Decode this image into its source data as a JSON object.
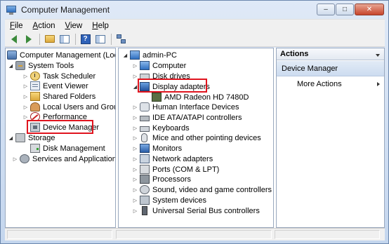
{
  "window": {
    "title": "Computer Management",
    "controls": {
      "minimize": "–",
      "maximize": "□",
      "close": "✕"
    }
  },
  "menubar": {
    "items": [
      {
        "label": "File",
        "accel": "F",
        "rest": "ile"
      },
      {
        "label": "Action",
        "accel": "A",
        "rest": "ction"
      },
      {
        "label": "View",
        "accel": "V",
        "rest": "iew"
      },
      {
        "label": "Help",
        "accel": "H",
        "rest": "elp"
      }
    ]
  },
  "toolbar": {
    "icons": [
      "back-arrow-icon",
      "forward-arrow-icon",
      "up-folder-icon",
      "show-hide-console-tree-icon",
      "help-icon",
      "show-hide-action-pane-icon",
      "connect-network-icon"
    ],
    "help_glyph": "?"
  },
  "left_tree": {
    "root": "Computer Management (Local",
    "system_tools": "System Tools",
    "task_scheduler": "Task Scheduler",
    "event_viewer": "Event Viewer",
    "shared_folders": "Shared Folders",
    "local_users": "Local Users and Groups",
    "performance": "Performance",
    "device_manager": "Device Manager",
    "storage": "Storage",
    "disk_management": "Disk Management",
    "services": "Services and Applications"
  },
  "device_tree": {
    "root": "admin-PC",
    "items": [
      "Computer",
      "Disk drives",
      "Display adapters",
      "AMD Radeon HD 7480D",
      "Human Interface Devices",
      "IDE ATA/ATAPI controllers",
      "Keyboards",
      "Mice and other pointing devices",
      "Monitors",
      "Network adapters",
      "Ports (COM & LPT)",
      "Processors",
      "Sound, video and game controllers",
      "System devices",
      "Universal Serial Bus controllers"
    ]
  },
  "actions": {
    "header": "Actions",
    "section": "Device Manager",
    "more": "More Actions"
  },
  "colors": {
    "highlight": "#e0141e",
    "title_bar": "#c4d6ee",
    "actions_section": "#cddcf0"
  }
}
